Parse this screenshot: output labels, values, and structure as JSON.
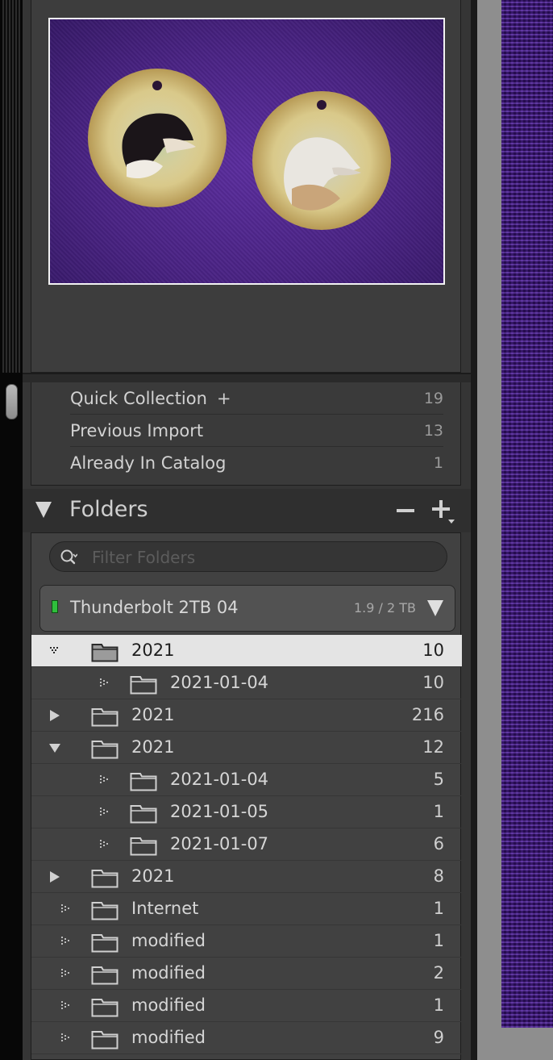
{
  "collections": {
    "quick_collection": {
      "label": "Quick Collection",
      "plus": "+",
      "count": "19"
    },
    "previous_import": {
      "label": "Previous Import",
      "count": "13"
    },
    "already_in_catalog": {
      "label": "Already In Catalog",
      "count": "1"
    }
  },
  "folders_panel": {
    "title": "Folders",
    "minus_icon": "minus-icon",
    "plus_icon": "plus-dropdown-icon",
    "filter_placeholder": "Filter Folders",
    "volume": {
      "name": "Thunderbolt 2TB 04",
      "size": "1.9 / 2 TB",
      "status_color": "#2fbf3c"
    },
    "folders": [
      {
        "name": "2021",
        "count": "10",
        "level": 0,
        "state": "expanded",
        "selected": true
      },
      {
        "name": "2021-01-04",
        "count": "10",
        "level": 1,
        "state": "leaf"
      },
      {
        "name": "2021",
        "count": "216",
        "level": 0,
        "state": "collapsed"
      },
      {
        "name": "2021",
        "count": "12",
        "level": 0,
        "state": "expanded"
      },
      {
        "name": "2021-01-04",
        "count": "5",
        "level": 1,
        "state": "leaf"
      },
      {
        "name": "2021-01-05",
        "count": "1",
        "level": 1,
        "state": "leaf"
      },
      {
        "name": "2021-01-07",
        "count": "6",
        "level": 1,
        "state": "leaf"
      },
      {
        "name": "2021",
        "count": "8",
        "level": 0,
        "state": "collapsed"
      },
      {
        "name": "Internet",
        "count": "1",
        "level": 0,
        "state": "leaf"
      },
      {
        "name": "modified",
        "count": "1",
        "level": 0,
        "state": "leaf"
      },
      {
        "name": "modified",
        "count": "2",
        "level": 0,
        "state": "leaf"
      },
      {
        "name": "modified",
        "count": "1",
        "level": 0,
        "state": "leaf"
      },
      {
        "name": "modified",
        "count": "9",
        "level": 0,
        "state": "leaf"
      }
    ]
  },
  "colors": {
    "accent_selected_row": "#e4e4e4",
    "panel_bg": "#353535",
    "preview_bg": "#4a2384"
  }
}
